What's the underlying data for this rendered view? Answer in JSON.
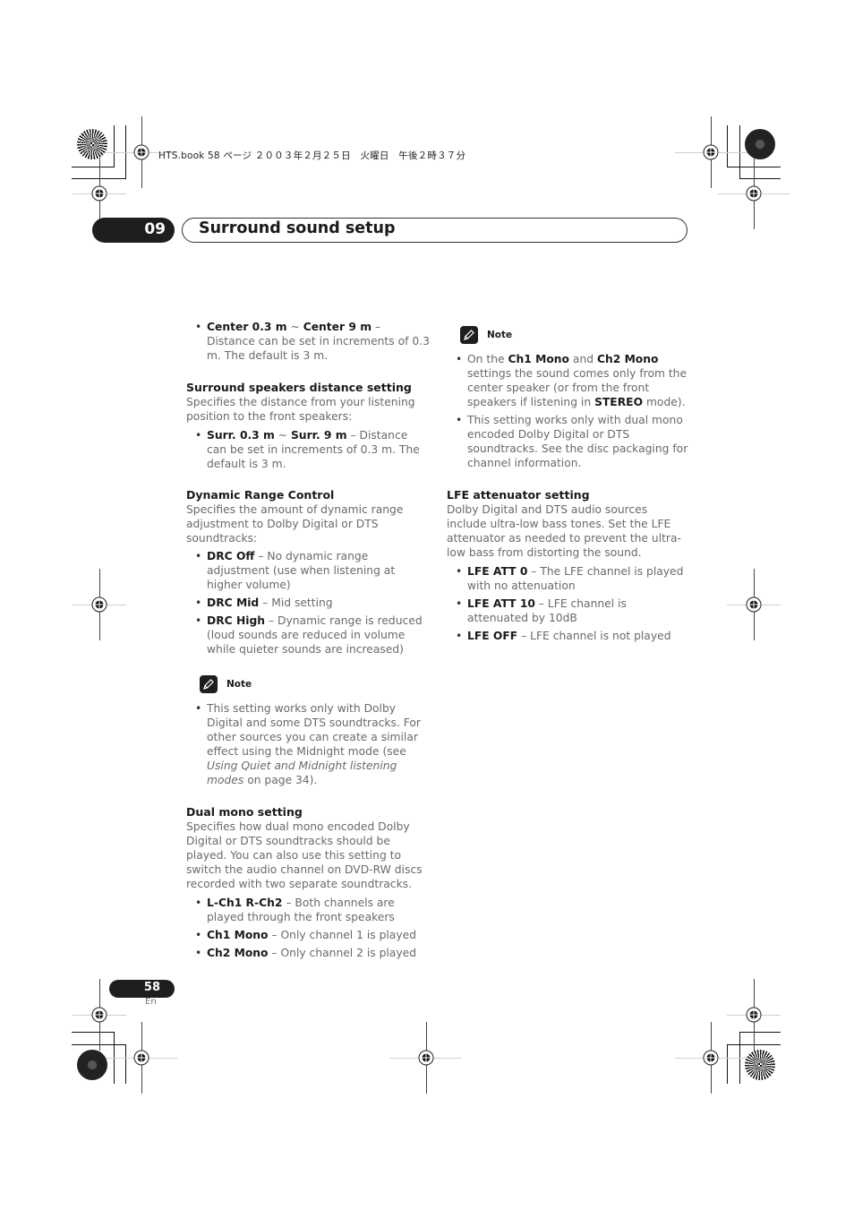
{
  "print_header": "HTS.book  58 ページ  ２００３年２月２５日　火曜日　午後２時３７分",
  "chapter": {
    "number": "09",
    "title": "Surround sound setup"
  },
  "left_column": {
    "center_bullet": {
      "term": "Center 0.3 m",
      "sep": " ~ ",
      "term2": "Center 9 m",
      "desc": " – Distance can be set in increments of 0.3 m. The default is 3 m."
    },
    "surround": {
      "heading": "Surround speakers distance setting",
      "intro": "Specifies the distance from your listening position to the front speakers:",
      "bullet": {
        "term": "Surr. 0.3 m",
        "sep": " ~ ",
        "term2": "Surr. 9 m",
        "desc": " – Distance can be set in increments of 0.3 m. The default is 3 m."
      }
    },
    "drc": {
      "heading": "Dynamic Range Control",
      "intro": "Specifies the amount of dynamic range adjustment to Dolby Digital or DTS soundtracks:",
      "bullets": [
        {
          "term": "DRC Off",
          "desc": " – No dynamic range adjustment (use when listening at higher volume)"
        },
        {
          "term": "DRC Mid",
          "desc": " – Mid setting"
        },
        {
          "term": "DRC High",
          "desc": " – Dynamic range is reduced (loud sounds are reduced in volume while quieter sounds are increased)"
        }
      ]
    },
    "note": {
      "label": "Note",
      "text_before": "This setting works only with Dolby Digital and some DTS soundtracks. For other sources you can create a similar effect using the Midnight mode (see ",
      "link_italic": "Using Quiet and Midnight listening modes",
      "text_after": " on page 34)."
    },
    "dual_mono": {
      "heading": "Dual mono setting",
      "intro": "Specifies how dual mono encoded Dolby Digital or DTS soundtracks should be played. You can also use this setting to switch the audio channel on DVD-RW discs recorded with two separate soundtracks.",
      "bullets": [
        {
          "term": "L-Ch1 R-Ch2",
          "desc": " – Both channels are played through the front speakers"
        },
        {
          "term": "Ch1 Mono",
          "desc": " – Only channel 1 is played"
        },
        {
          "term": "Ch2 Mono",
          "desc": " – Only channel 2 is played"
        }
      ]
    }
  },
  "right_column": {
    "note": {
      "label": "Note",
      "b1_pre": "On the ",
      "b1_t1": "Ch1 Mono",
      "b1_mid": " and ",
      "b1_t2": "Ch2 Mono",
      "b1_post": " settings the sound comes only from the center speaker (or from the front speakers if listening in ",
      "b1_t3": "STEREO",
      "b1_end": " mode).",
      "b2": "This setting works only with dual mono encoded Dolby Digital or DTS soundtracks. See the disc packaging for channel information."
    },
    "lfe": {
      "heading": "LFE attenuator setting",
      "intro": "Dolby Digital and DTS audio sources include ultra-low bass tones. Set the LFE attenuator as needed to prevent the ultra-low bass from distorting the sound.",
      "bullets": [
        {
          "term": "LFE ATT 0",
          "desc": " – The LFE channel is played with no attenuation"
        },
        {
          "term": "LFE ATT 10",
          "desc": " – LFE channel is attenuated by 10dB"
        },
        {
          "term": "LFE OFF",
          "desc": " – LFE channel is not played"
        }
      ]
    }
  },
  "footer": {
    "page_number": "58",
    "language": "En"
  }
}
